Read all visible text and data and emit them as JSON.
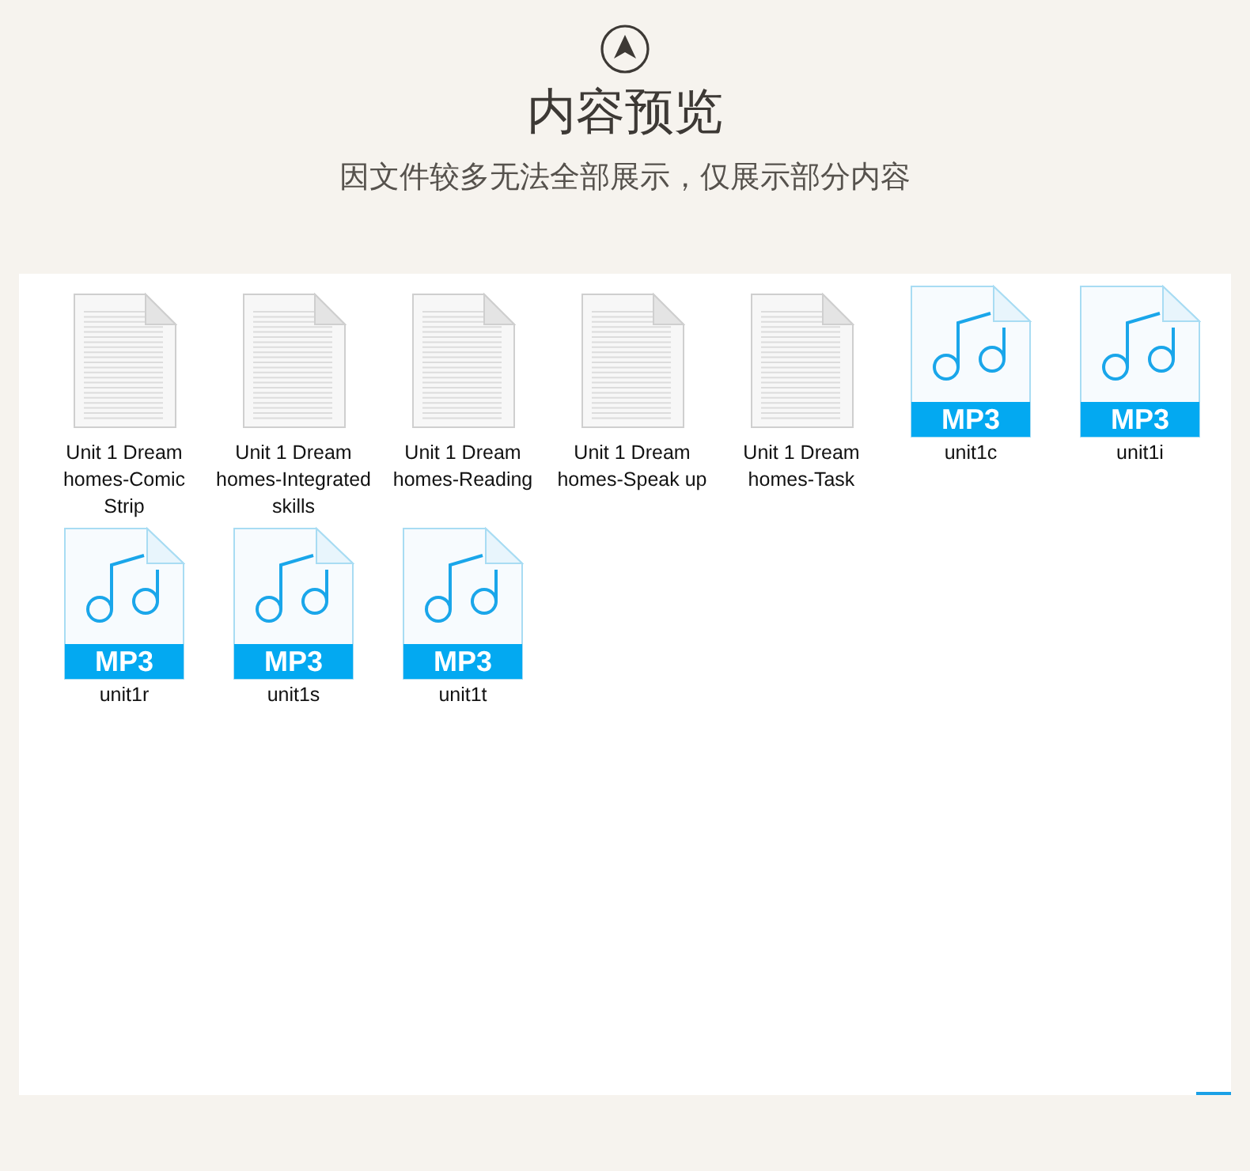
{
  "header": {
    "title": "内容预览",
    "subtitle": "因文件较多无法全部展示，仅展示部分内容"
  },
  "files": [
    {
      "kind": "document",
      "name": "Unit 1 Dream homes-Comic Strip"
    },
    {
      "kind": "document",
      "name": "Unit 1 Dream homes-Integrated skills"
    },
    {
      "kind": "document",
      "name": "Unit 1 Dream homes-Reading"
    },
    {
      "kind": "document",
      "name": "Unit 1 Dream homes-Speak up"
    },
    {
      "kind": "document",
      "name": "Unit 1 Dream homes-Task"
    },
    {
      "kind": "audio",
      "badge": "MP3",
      "name": "unit1c"
    },
    {
      "kind": "audio",
      "badge": "MP3",
      "name": "unit1i"
    },
    {
      "kind": "audio",
      "badge": "MP3",
      "name": "unit1r"
    },
    {
      "kind": "audio",
      "badge": "MP3",
      "name": "unit1s"
    },
    {
      "kind": "audio",
      "badge": "MP3",
      "name": "unit1t"
    }
  ]
}
